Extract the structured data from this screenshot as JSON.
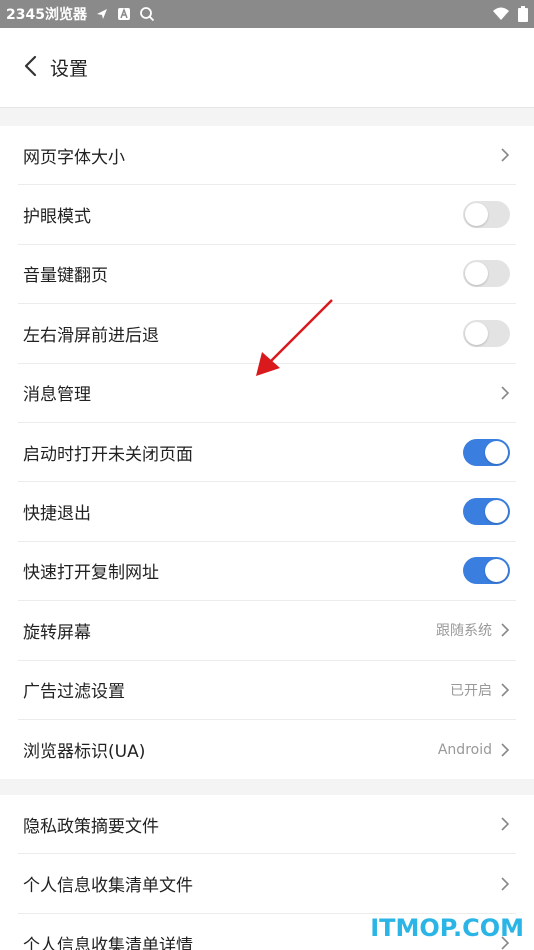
{
  "status_bar": {
    "app_name": "2345浏览器",
    "icons": [
      "nav-arrow-icon",
      "font-a-icon",
      "search-icon",
      "wifi-icon",
      "battery-icon"
    ]
  },
  "header": {
    "back_icon": "chevron-left-icon",
    "title": "设置"
  },
  "settings_group_1": [
    {
      "label": "网页字体大小",
      "type": "link",
      "value": ""
    },
    {
      "label": "护眼模式",
      "type": "toggle",
      "on": false
    },
    {
      "label": "音量键翻页",
      "type": "toggle",
      "on": false
    },
    {
      "label": "左右滑屏前进后退",
      "type": "toggle",
      "on": false
    },
    {
      "label": "消息管理",
      "type": "link",
      "value": ""
    },
    {
      "label": "启动时打开未关闭页面",
      "type": "toggle",
      "on": true
    },
    {
      "label": "快捷退出",
      "type": "toggle",
      "on": true
    },
    {
      "label": "快速打开复制网址",
      "type": "toggle",
      "on": true
    },
    {
      "label": "旋转屏幕",
      "type": "link",
      "value": "跟随系统"
    },
    {
      "label": "广告过滤设置",
      "type": "link",
      "value": "已开启"
    },
    {
      "label": "浏览器标识(UA)",
      "type": "link",
      "value": "Android"
    }
  ],
  "settings_group_2": [
    {
      "label": "隐私政策摘要文件",
      "type": "link",
      "value": ""
    },
    {
      "label": "个人信息收集清单文件",
      "type": "link",
      "value": ""
    },
    {
      "label": "个人信息收集清单详情",
      "type": "link",
      "value": ""
    }
  ],
  "watermark": "ITMOP.COM",
  "colors": {
    "accent": "#3a7fe0",
    "toggle_off": "#e3e3e3",
    "annotation_arrow": "#d9191c",
    "watermark": "#2bb5e6"
  }
}
